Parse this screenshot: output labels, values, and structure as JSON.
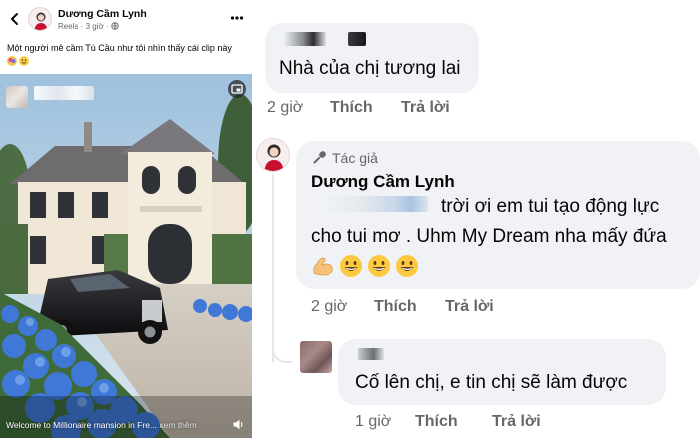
{
  "post": {
    "author_name": "Dương Cầm Lynh",
    "meta": "Reels · 3 giờ · ",
    "caption": "Một người mê cầm Tú Cầu như tôi nhìn thấy cái clip này",
    "reel": {
      "caption_text": "Welcome to Millionaire mansion in Fre...",
      "see_more": " xem thêm"
    }
  },
  "comments": [
    {
      "text": "Nhà của chị tương lai",
      "time": "2 giờ",
      "like": "Thích",
      "reply": "Trả lời"
    },
    {
      "badge": "Tác giả",
      "author": "Dương Cầm Lynh",
      "text_line1": "trời ơi em tui tạo động lực",
      "text_line2": "cho tui mơ . Uhm My Dream nha mấy đứa",
      "time": "2 giờ",
      "like": "Thích",
      "reply": "Trả lời"
    },
    {
      "text": "Cố lên chị, e tin chị sẽ làm được",
      "time": "1 giờ",
      "like": "Thích",
      "reply": "Trả lời"
    }
  ],
  "colors": {
    "bubble_bg": "#f0f2f5",
    "secondary_text": "#65676b",
    "primary_text": "#050505"
  },
  "icons": [
    "back-arrow-icon",
    "more-icon",
    "picture-in-picture-icon",
    "volume-icon",
    "microphone-icon",
    "flexed-biceps-emoji",
    "grinning-emoji"
  ]
}
